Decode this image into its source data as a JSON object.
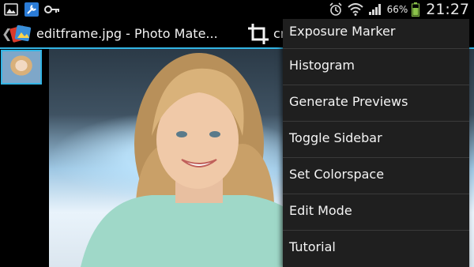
{
  "status_bar": {
    "battery_percent": "66%",
    "time": "21:27"
  },
  "action_bar": {
    "back_glyph": "❮",
    "title": "editframe.jpg - Photo Mate...",
    "crop_label": "cr"
  },
  "menu": {
    "items": [
      {
        "label": "Exposure Marker"
      },
      {
        "label": "Histogram"
      },
      {
        "label": "Generate Previews"
      },
      {
        "label": "Toggle Sidebar"
      },
      {
        "label": "Set Colorspace"
      },
      {
        "label": "Edit Mode"
      },
      {
        "label": "Tutorial"
      }
    ]
  },
  "colors": {
    "accent": "#33b5e5",
    "menu_background": "#1f1f1f",
    "battery": "#8bc34a"
  },
  "icons": [
    "gallery-icon",
    "tools-icon",
    "key-icon",
    "alarm-icon",
    "wifi-icon",
    "signal-icon",
    "battery-icon",
    "crop-icon",
    "app-icon"
  ]
}
